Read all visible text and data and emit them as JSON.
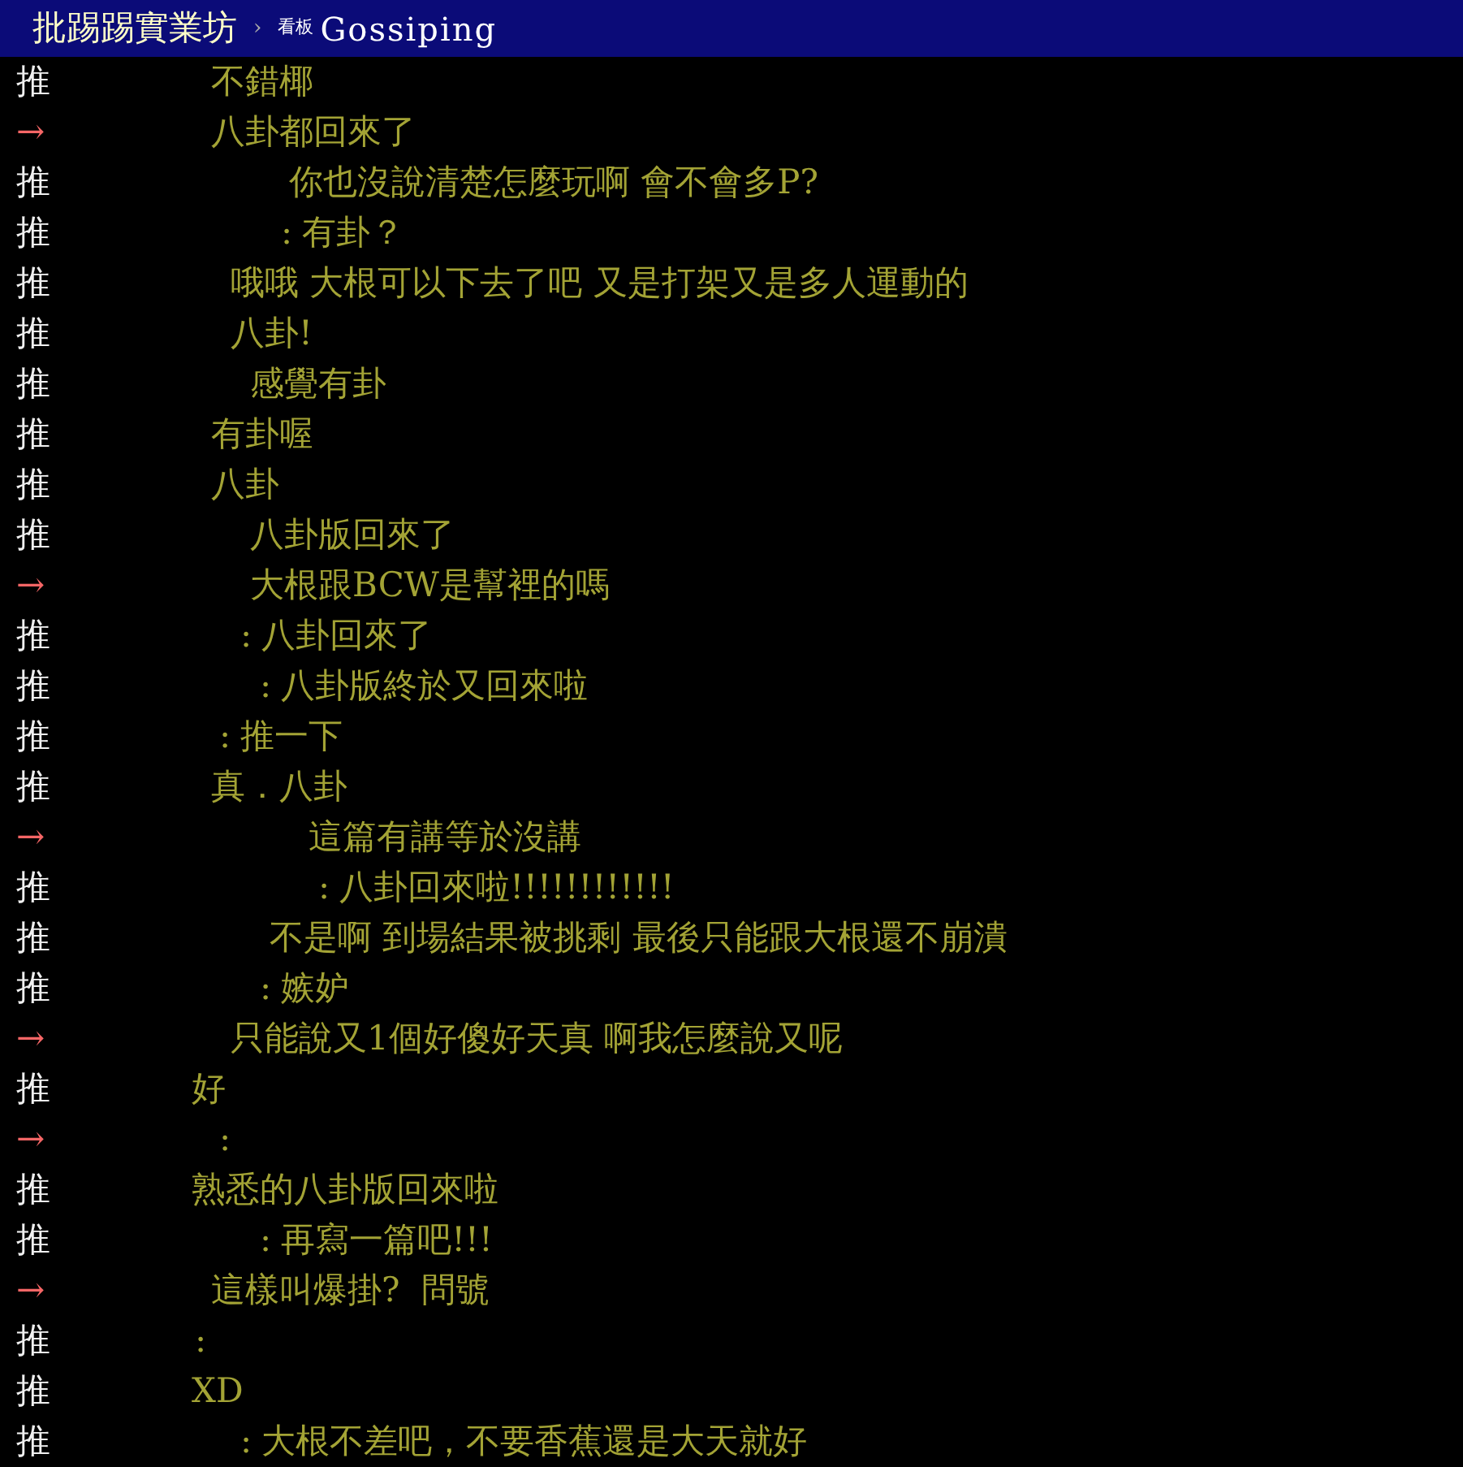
{
  "header": {
    "site_title": "批踢踢實業坊",
    "separator": "›",
    "board_label": "看板",
    "board_name": "Gossiping"
  },
  "pushes": [
    {
      "kind": "push",
      "tag": "推",
      "content": "不錯椰"
    },
    {
      "kind": "arrow",
      "tag": "→",
      "content": "八卦都回來了"
    },
    {
      "kind": "push",
      "tag": "推",
      "content": "你也沒說清楚怎麼玩啊 會不會多P?"
    },
    {
      "kind": "push",
      "tag": "推",
      "colon": ":",
      "content": "有卦？"
    },
    {
      "kind": "push",
      "tag": "推",
      "content": "哦哦 大根可以下去了吧 又是打架又是多人運動的"
    },
    {
      "kind": "push",
      "tag": "推",
      "content": "八卦!"
    },
    {
      "kind": "push",
      "tag": "推",
      "content": "感覺有卦"
    },
    {
      "kind": "push",
      "tag": "推",
      "content": "有卦喔"
    },
    {
      "kind": "push",
      "tag": "推",
      "content": "八卦"
    },
    {
      "kind": "push",
      "tag": "推",
      "content": "八卦版回來了"
    },
    {
      "kind": "arrow",
      "tag": "→",
      "content": "大根跟BCW是幫裡的嗎"
    },
    {
      "kind": "push",
      "tag": "推",
      "colon": ":",
      "content": "八卦回來了"
    },
    {
      "kind": "push",
      "tag": "推",
      "colon": ":",
      "content": "八卦版終於又回來啦"
    },
    {
      "kind": "push",
      "tag": "推",
      "colon": ":",
      "content": "推一下"
    },
    {
      "kind": "push",
      "tag": "推",
      "content": "真．八卦"
    },
    {
      "kind": "arrow",
      "tag": "→",
      "content": "這篇有講等於沒講"
    },
    {
      "kind": "push",
      "tag": "推",
      "colon": ":",
      "content": "八卦回來啦!!!!!!!!!!!!"
    },
    {
      "kind": "push",
      "tag": "推",
      "content": "不是啊 到場結果被挑剩 最後只能跟大根還不崩潰"
    },
    {
      "kind": "push",
      "tag": "推",
      "colon": ":",
      "content": "嫉妒"
    },
    {
      "kind": "arrow",
      "tag": "→",
      "content": "只能說又1個好傻好天真 啊我怎麼說又呢"
    },
    {
      "kind": "push",
      "tag": "推",
      "content": "好"
    },
    {
      "kind": "arrow",
      "tag": "→",
      "colon": ":"
    },
    {
      "kind": "push",
      "tag": "推",
      "content": "熟悉的八卦版回來啦"
    },
    {
      "kind": "push",
      "tag": "推",
      "colon": ":",
      "content": "再寫一篇吧!!!"
    },
    {
      "kind": "arrow",
      "tag": "→",
      "content": "這樣叫爆掛?  問號"
    },
    {
      "kind": "push",
      "tag": "推",
      "colon": ":"
    },
    {
      "kind": "push",
      "tag": "推",
      "content": "XD"
    },
    {
      "kind": "push",
      "tag": "推",
      "colon": ":",
      "content": "大根不差吧，不要香蕉還是大天就好"
    }
  ]
}
